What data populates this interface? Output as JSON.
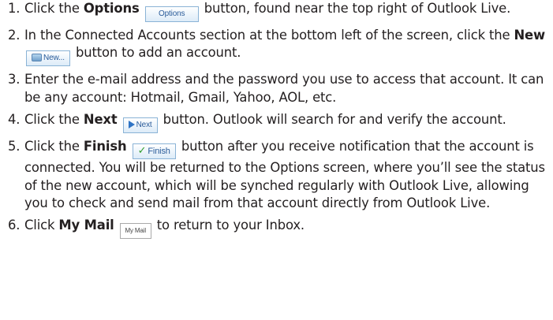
{
  "steps": [
    {
      "number": "1.",
      "pre": "Click the ",
      "bold": "Options",
      "button_label": "Options",
      "post": " button, found near the top right of Outlook Live."
    },
    {
      "number": "2.",
      "pre": "In the Connected Accounts section at the bottom left of the screen, click the ",
      "bold": "New",
      "button_icon": "new-account-icon",
      "button_label": "New...",
      "post": " button to add an account."
    },
    {
      "number": "3.",
      "text": "Enter the e-mail address and the password you use to access that account. It can be any account: Hotmail, Gmail, Yahoo, AOL, etc."
    },
    {
      "number": "4.",
      "pre": "Click the ",
      "bold": "Next",
      "button_icon": "arrow-right-icon",
      "button_label": "Next",
      "post": " button. Outlook will search for and verify the account."
    },
    {
      "number": "5.",
      "pre": "Click the ",
      "bold": "Finish",
      "button_icon": "checkmark-icon",
      "button_label": "Finish",
      "post": " button after you receive notification that the account is connected. You will be returned to the Options screen, where you’ll see the status of the new account, which will be synched regularly with Outlook Live, allowing you to check and send mail from that account directly from Outlook Live."
    },
    {
      "number": "6.",
      "pre": "Click ",
      "bold": "My Mail",
      "button_label": "My Mail",
      "post": " to return to your Inbox."
    }
  ],
  "colors": {
    "text": "#231f20",
    "button_text": "#2a5c9a",
    "button_border": "#8ab3d6",
    "check_icon": "#2e9d2e"
  }
}
